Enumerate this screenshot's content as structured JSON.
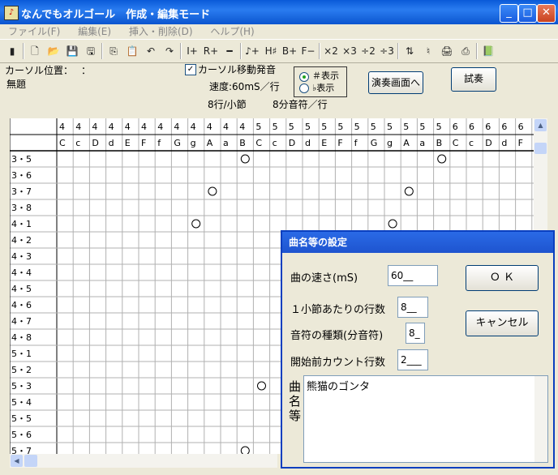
{
  "window": {
    "title": "なんでもオルゴール　作成・編集モード",
    "icon": "music-box-icon"
  },
  "menu": [
    {
      "label": "ファイル(F)"
    },
    {
      "label": "編集(E)"
    },
    {
      "label": "挿入・削除(D)"
    },
    {
      "label": "ヘルプ(H)"
    }
  ],
  "toolbar": {
    "buttons": [
      {
        "name": "exit-icon",
        "glyph": "▮"
      },
      {
        "name": "new-file-icon",
        "glyph": "🗋"
      },
      {
        "name": "open-folder-icon",
        "glyph": "📂"
      },
      {
        "name": "save-icon",
        "glyph": "💾"
      },
      {
        "name": "save-as-icon",
        "glyph": "🖫"
      },
      {
        "name": "copy-icon",
        "glyph": "⎘"
      },
      {
        "name": "paste-icon",
        "glyph": "📋"
      },
      {
        "name": "undo-icon",
        "glyph": "↶"
      },
      {
        "name": "redo-icon",
        "glyph": "↷"
      },
      {
        "name": "insert-line-icon",
        "glyph": "I+"
      },
      {
        "name": "insert-row-icon",
        "glyph": "R+"
      },
      {
        "name": "delete-line-icon",
        "glyph": "━"
      },
      {
        "name": "sharp-note-icon",
        "glyph": "♪+"
      },
      {
        "name": "sharp-icon",
        "glyph": "H♯"
      },
      {
        "name": "flat-plus-icon",
        "glyph": "B+"
      },
      {
        "name": "flat-minus-icon",
        "glyph": "F−"
      },
      {
        "name": "times-2-icon",
        "glyph": "×2"
      },
      {
        "name": "times-3-icon",
        "glyph": "×3"
      },
      {
        "name": "divide-2-icon",
        "glyph": "÷2"
      },
      {
        "name": "divide-3-icon",
        "glyph": "÷3"
      },
      {
        "name": "sort-icon",
        "glyph": "⇅"
      },
      {
        "name": "tuning-icon",
        "glyph": "♮"
      },
      {
        "name": "print-icon",
        "glyph": "🖨"
      },
      {
        "name": "print-preview-icon",
        "glyph": "⎙"
      },
      {
        "name": "book-icon",
        "glyph": "📗"
      }
    ]
  },
  "info": {
    "cursor_label": "カーソル位置：",
    "cursor_sep": "：",
    "song_title": "無題",
    "cursor_sound_checkbox": {
      "label": "カーソル移動発音",
      "checked": true
    },
    "speed": "速度:60mS／行",
    "rows_per_bar": "8行/小節",
    "note_type": "8分音符／行",
    "radio": {
      "sharp": "＃表示",
      "flat": "♭表示",
      "selected": "sharp"
    },
    "performance_button": "演奏画面へ",
    "play_button": "試奏"
  },
  "grid": {
    "octaves": [
      "4",
      "4",
      "4",
      "4",
      "4",
      "4",
      "4",
      "4",
      "4",
      "4",
      "4",
      "4",
      "5",
      "5",
      "5",
      "5",
      "5",
      "5",
      "5",
      "5",
      "5",
      "5",
      "5",
      "5",
      "6",
      "6",
      "6",
      "6",
      "6"
    ],
    "notes": [
      "C",
      "c",
      "D",
      "d",
      "E",
      "F",
      "f",
      "G",
      "g",
      "A",
      "a",
      "B",
      "C",
      "c",
      "D",
      "d",
      "E",
      "F",
      "f",
      "G",
      "g",
      "A",
      "a",
      "B",
      "C",
      "c",
      "D",
      "d",
      "F"
    ],
    "rows": [
      "3・5",
      "3・6",
      "3・7",
      "3・8",
      "4・1",
      "4・2",
      "4・3",
      "4・4",
      "4・5",
      "4・6",
      "4・7",
      "4・8",
      "5・1",
      "5・2",
      "5・3",
      "5・4",
      "5・5",
      "5・6",
      "5・7"
    ],
    "marks": [
      {
        "row": 0,
        "col": 11
      },
      {
        "row": 0,
        "col": 23
      },
      {
        "row": 2,
        "col": 9
      },
      {
        "row": 2,
        "col": 21
      },
      {
        "row": 4,
        "col": 8
      },
      {
        "row": 4,
        "col": 20
      },
      {
        "row": 14,
        "col": 12
      },
      {
        "row": 18,
        "col": 11
      }
    ]
  },
  "dialog": {
    "title": "曲名等の設定",
    "speed_label": "曲の速さ(mS)",
    "speed_value": "60__",
    "rows_per_bar_label": "１小節あたりの行数",
    "rows_per_bar_value": "8__",
    "note_type_label": "音符の種類(分音符)",
    "note_type_value": "8_",
    "pre_count_label": "開始前カウント行数",
    "pre_count_value": "2___",
    "song_name_label": "曲名等",
    "song_name_value": "熊猫のゴンタ",
    "ok_button": "Ｏ Ｋ",
    "cancel_button": "キャンセル"
  }
}
